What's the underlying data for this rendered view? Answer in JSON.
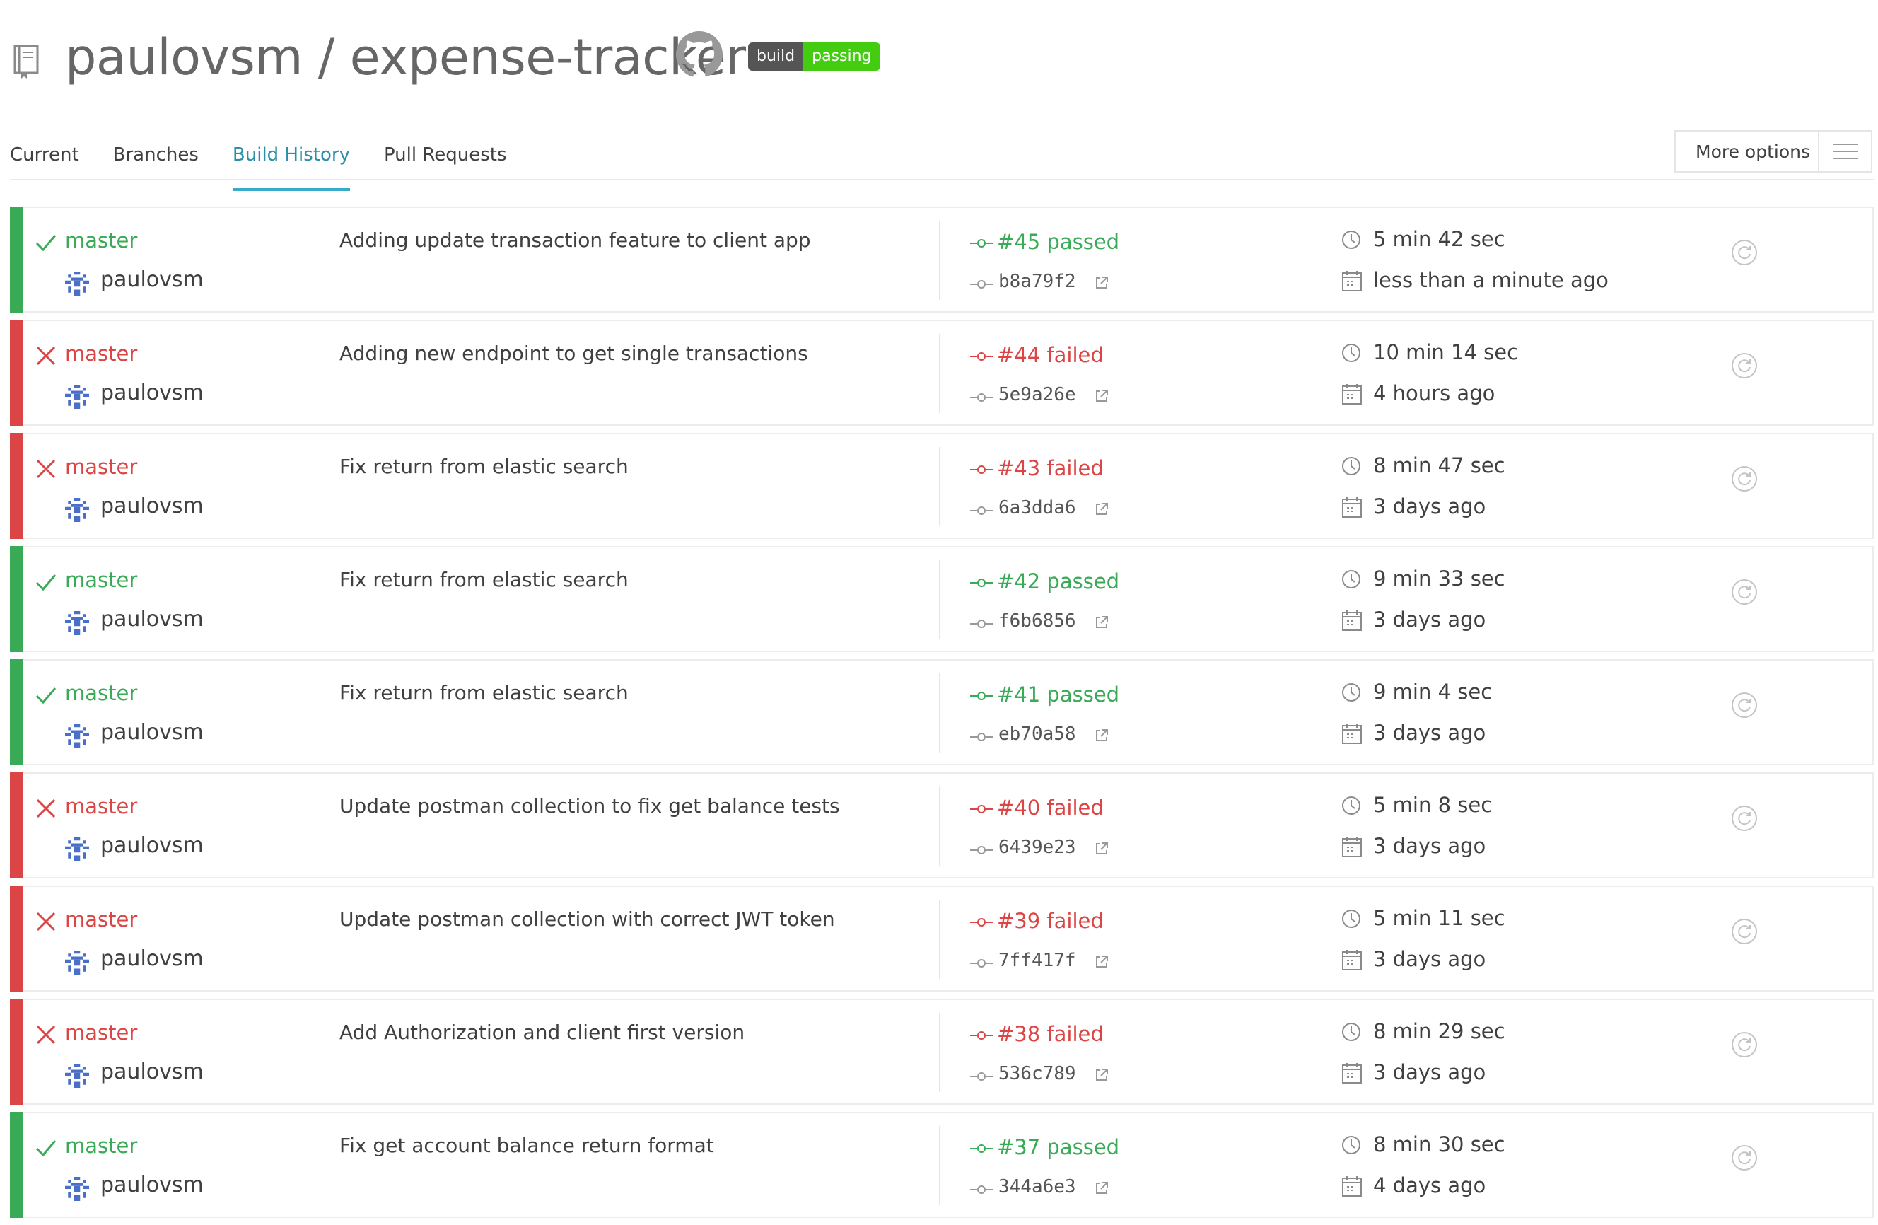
{
  "repo": {
    "title": "paulovsm / expense-tracker",
    "badge_left": "build",
    "badge_right": "passing"
  },
  "tabs": [
    {
      "label": "Current"
    },
    {
      "label": "Branches"
    },
    {
      "label": "Build History",
      "active": true
    },
    {
      "label": "Pull Requests"
    }
  ],
  "more_options": {
    "label": "More options"
  },
  "colors": {
    "passed": "#39aa56",
    "failed": "#db4545",
    "accent": "#39aaca"
  },
  "icons": {
    "passed": "checkmark-icon",
    "failed": "cross-icon",
    "commit": "commit-icon",
    "external": "external-link-icon",
    "clock": "clock-icon",
    "calendar": "calendar-icon",
    "restart": "restart-icon",
    "menu": "hamburger-icon",
    "repo": "repo-book-icon",
    "github": "github-icon"
  },
  "builds": [
    {
      "status": "passed",
      "branch": "master",
      "author": "paulovsm",
      "message": "Adding update transaction feature to client app",
      "number": "#45 passed",
      "sha": "b8a79f2",
      "duration": "5 min 42 sec",
      "finished": "less than a minute ago"
    },
    {
      "status": "failed",
      "branch": "master",
      "author": "paulovsm",
      "message": "Adding new endpoint to get single transactions",
      "number": "#44 failed",
      "sha": "5e9a26e",
      "duration": "10 min 14 sec",
      "finished": "4 hours ago"
    },
    {
      "status": "failed",
      "branch": "master",
      "author": "paulovsm",
      "message": "Fix return from elastic search",
      "number": "#43 failed",
      "sha": "6a3dda6",
      "duration": "8 min 47 sec",
      "finished": "3 days ago"
    },
    {
      "status": "passed",
      "branch": "master",
      "author": "paulovsm",
      "message": "Fix return from elastic search",
      "number": "#42 passed",
      "sha": "f6b6856",
      "duration": "9 min 33 sec",
      "finished": "3 days ago"
    },
    {
      "status": "passed",
      "branch": "master",
      "author": "paulovsm",
      "message": "Fix return from elastic search",
      "number": "#41 passed",
      "sha": "eb70a58",
      "duration": "9 min 4 sec",
      "finished": "3 days ago"
    },
    {
      "status": "failed",
      "branch": "master",
      "author": "paulovsm",
      "message": "Update postman collection to fix get balance tests",
      "number": "#40 failed",
      "sha": "6439e23",
      "duration": "5 min 8 sec",
      "finished": "3 days ago"
    },
    {
      "status": "failed",
      "branch": "master",
      "author": "paulovsm",
      "message": "Update postman collection with correct JWT token",
      "number": "#39 failed",
      "sha": "7ff417f",
      "duration": "5 min 11 sec",
      "finished": "3 days ago"
    },
    {
      "status": "failed",
      "branch": "master",
      "author": "paulovsm",
      "message": "Add Authorization and client first version",
      "number": "#38 failed",
      "sha": "536c789",
      "duration": "8 min 29 sec",
      "finished": "3 days ago"
    },
    {
      "status": "passed",
      "branch": "master",
      "author": "paulovsm",
      "message": "Fix get account balance return format",
      "number": "#37 passed",
      "sha": "344a6e3",
      "duration": "8 min 30 sec",
      "finished": "4 days ago"
    }
  ]
}
